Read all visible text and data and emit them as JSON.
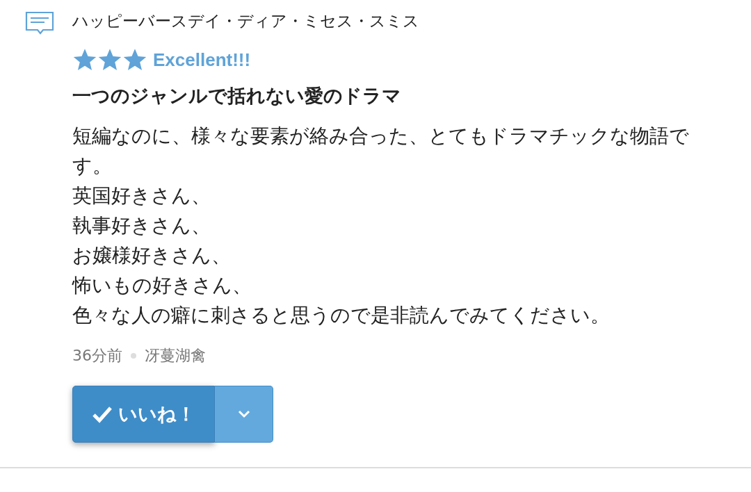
{
  "review": {
    "work_title": "ハッピーバースデイ・ディア・ミセス・スミス",
    "stars": 3,
    "rating_label": "Excellent!!!",
    "heading": "一つのジャンルで括れない愛のドラマ",
    "body_lines": [
      "短編なのに、様々な要素が絡み合った、とてもドラマチックな物語です。",
      "英国好きさん、",
      "執事好きさん、",
      "お嬢様好きさん、",
      "怖いもの好きさん、",
      "色々な人の癖に刺さると思うので是非読んでみてください。"
    ],
    "time": "36分前",
    "author": "冴蔓湖禽",
    "like_button": {
      "label": "いいね！",
      "liked": true
    }
  }
}
